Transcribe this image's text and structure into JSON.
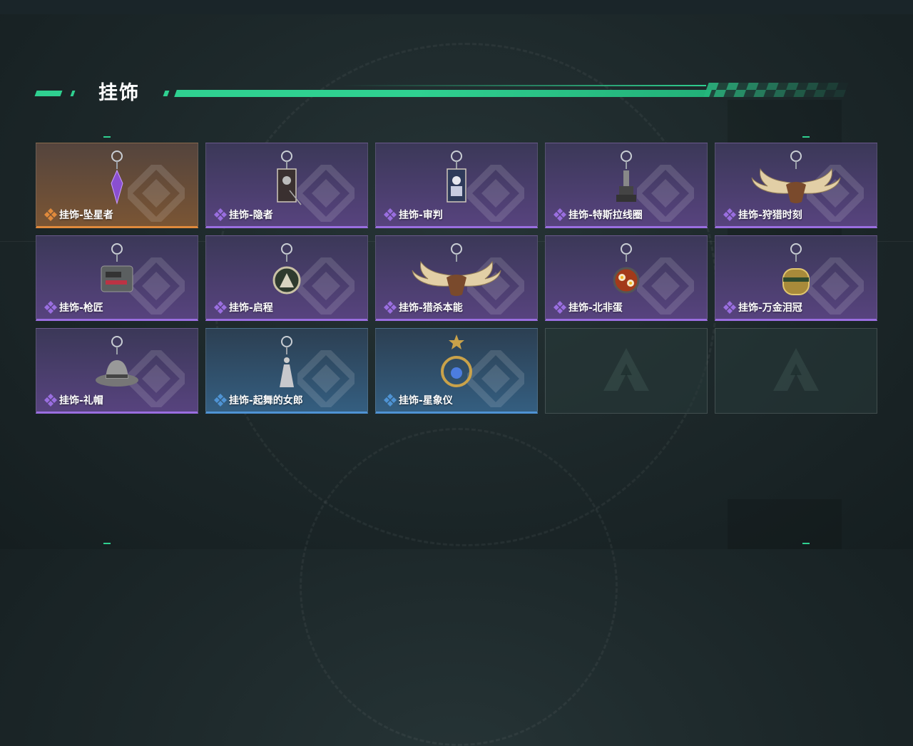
{
  "header": {
    "title": "挂饰"
  },
  "colors": {
    "accent": "#2fd090",
    "rarity_orange": "#e08a3c",
    "rarity_purple": "#9a6ee0",
    "rarity_blue": "#4f93d4"
  },
  "items": [
    {
      "name": "挂饰-坠星者",
      "rarity": "orange",
      "icon": "purple-crystal-pendant-icon"
    },
    {
      "name": "挂饰-隐者",
      "rarity": "purple",
      "icon": "tarot-card-hermit-icon"
    },
    {
      "name": "挂饰-审判",
      "rarity": "purple",
      "icon": "tarot-card-judgement-icon"
    },
    {
      "name": "挂饰-特斯拉线圈",
      "rarity": "purple",
      "icon": "tesla-coil-icon"
    },
    {
      "name": "挂饰-狩猎时刻",
      "rarity": "purple",
      "icon": "moose-antlers-icon"
    },
    {
      "name": "挂饰-枪匠",
      "rarity": "purple",
      "icon": "gun-parts-icon"
    },
    {
      "name": "挂饰-启程",
      "rarity": "purple",
      "icon": "mountain-medallion-icon"
    },
    {
      "name": "挂饰-猎杀本能",
      "rarity": "purple",
      "icon": "moose-antlers-icon"
    },
    {
      "name": "挂饰-北非蛋",
      "rarity": "purple",
      "icon": "shakshuka-pan-icon"
    },
    {
      "name": "挂饰-万金泪冠",
      "rarity": "purple",
      "icon": "golden-crown-icon"
    },
    {
      "name": "挂饰-礼帽",
      "rarity": "purple",
      "icon": "fedora-hat-icon"
    },
    {
      "name": "挂饰-起舞的女郎",
      "rarity": "blue",
      "icon": "dancing-lady-figurine-icon"
    },
    {
      "name": "挂饰-星象仪",
      "rarity": "blue",
      "icon": "astrolabe-icon"
    },
    {
      "name": "",
      "rarity": "empty",
      "icon": "empty-slot-logo-icon"
    },
    {
      "name": "",
      "rarity": "empty",
      "icon": "empty-slot-logo-icon"
    }
  ]
}
